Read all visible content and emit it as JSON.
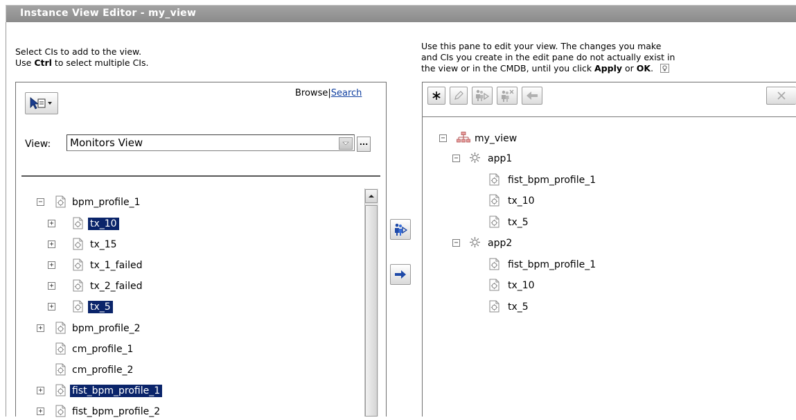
{
  "title": "Instance View Editor - my_view",
  "left_instructions": {
    "line1": "Select CIs to add to the view.",
    "line2_pre": "Use ",
    "line2_key": "Ctrl",
    "line2_post": " to select multiple CIs."
  },
  "right_instructions": {
    "line1": "Use this pane to edit your view. The changes you make",
    "line2": "and CIs you create in the edit pane do not actually exist in",
    "line3_pre": "the view or in the CMDB, until you click ",
    "apply": "Apply",
    "or": " or ",
    "ok": "OK",
    "end": "."
  },
  "left_pane": {
    "browse": "Browse",
    "separator": "|",
    "search": "Search",
    "view_label": "View:",
    "view_value": "Monitors View",
    "ellipsis": "...",
    "tree": [
      {
        "label": "bpm_profile_1",
        "expander": "−",
        "selected": false
      },
      {
        "label": "tx_10",
        "expander": "+",
        "selected": true
      },
      {
        "label": "tx_15",
        "expander": "+",
        "selected": false
      },
      {
        "label": "tx_1_failed",
        "expander": "+",
        "selected": false
      },
      {
        "label": "tx_2_failed",
        "expander": "+",
        "selected": false
      },
      {
        "label": "tx_5",
        "expander": "+",
        "selected": true
      },
      {
        "label": "bpm_profile_2",
        "expander": "+",
        "selected": false
      },
      {
        "label": "cm_profile_1",
        "expander": "",
        "selected": false
      },
      {
        "label": "cm_profile_2",
        "expander": "",
        "selected": false
      },
      {
        "label": "fist_bpm_profile_1",
        "expander": "+",
        "selected": true
      },
      {
        "label": "fist_bpm_profile_2",
        "expander": "+",
        "selected": false
      }
    ]
  },
  "right_pane": {
    "tree": [
      {
        "label": "my_view",
        "expander": "−",
        "icon": "view-icon"
      },
      {
        "label": "app1",
        "expander": "−",
        "icon": "gear-icon"
      },
      {
        "label": "fist_bpm_profile_1",
        "expander": "",
        "icon": "ci-icon"
      },
      {
        "label": "tx_10",
        "expander": "",
        "icon": "ci-icon"
      },
      {
        "label": "tx_5",
        "expander": "",
        "icon": "ci-icon"
      },
      {
        "label": "app2",
        "expander": "−",
        "icon": "gear-icon"
      },
      {
        "label": "fist_bpm_profile_1",
        "expander": "",
        "icon": "ci-icon"
      },
      {
        "label": "tx_10",
        "expander": "",
        "icon": "ci-icon"
      },
      {
        "label": "tx_5",
        "expander": "",
        "icon": "ci-icon"
      }
    ]
  },
  "toolbar_icons": [
    "asterisk-icon",
    "pencil-icon",
    "add-ci-icon",
    "remove-ci-icon",
    "back-arrow-icon",
    "close-icon"
  ],
  "colors": {
    "title_bar": "#959595",
    "selection": "#0a246a",
    "link": "#1040a0"
  }
}
